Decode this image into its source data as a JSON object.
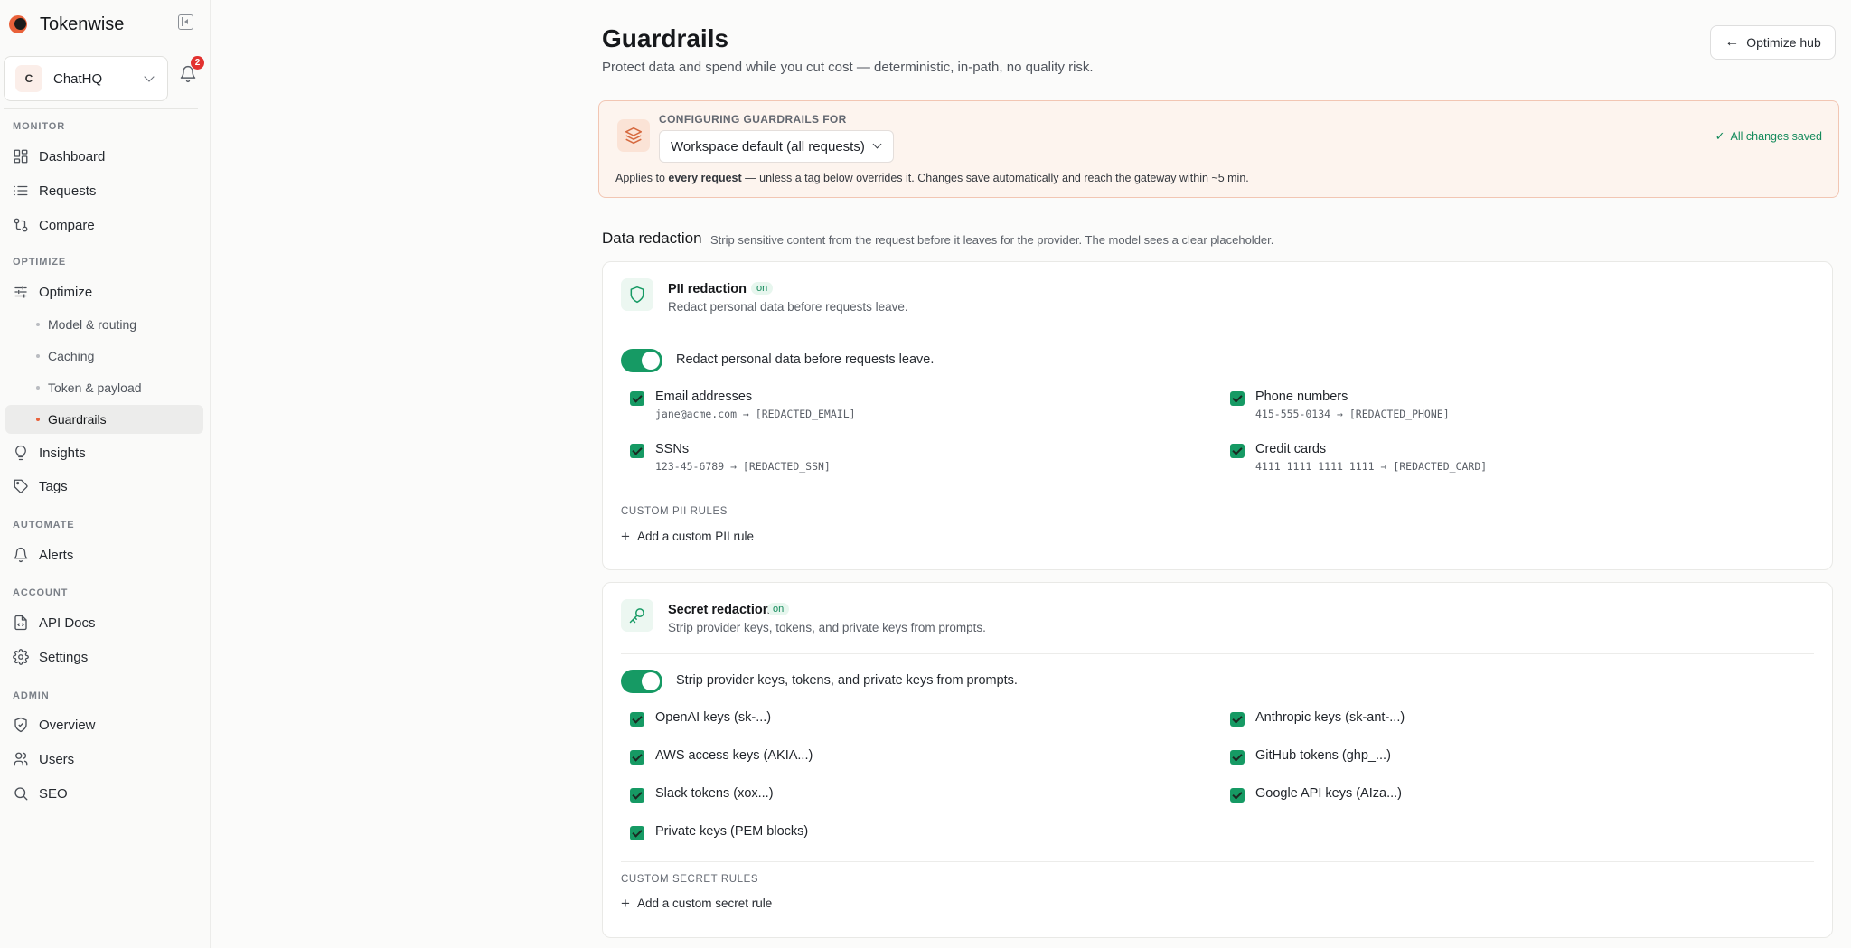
{
  "app": {
    "name": "Tokenwise"
  },
  "workspace": {
    "initial": "C",
    "name": "ChatHQ"
  },
  "notifications": {
    "count": "2"
  },
  "sidebar": {
    "monitor_label": "MONITOR",
    "dashboard": "Dashboard",
    "requests": "Requests",
    "compare": "Compare",
    "optimize_label": "OPTIMIZE",
    "optimize": "Optimize",
    "model_routing": "Model & routing",
    "caching": "Caching",
    "token_payload": "Token & payload",
    "guardrails": "Guardrails",
    "insights": "Insights",
    "tags": "Tags",
    "automate_label": "AUTOMATE",
    "alerts": "Alerts",
    "account_label": "ACCOUNT",
    "api_docs": "API Docs",
    "settings": "Settings",
    "admin_label": "ADMIN",
    "overview": "Overview",
    "users": "Users",
    "seo": "SEO"
  },
  "header": {
    "title": "Guardrails",
    "subtitle": "Protect data and spend while you cut cost — deterministic, in-path, no quality risk.",
    "back_button": "Optimize hub"
  },
  "config": {
    "label": "CONFIGURING GUARDRAILS FOR",
    "selected": "Workspace default (all requests)",
    "note_before": "Applies to ",
    "note_bold": "every request",
    "note_after": " — unless a tag below overrides it. Changes save automatically and reach the gateway within ~5 min.",
    "saved": "All changes saved"
  },
  "data_redaction": {
    "title": "Data redaction",
    "description": "Strip sensitive content from the request before it leaves for the provider. The model sees a clear placeholder."
  },
  "pii": {
    "title": "PII redaction",
    "status": "on",
    "subtitle": "Redact personal data before requests leave.",
    "toggle_label": "Redact personal data before requests leave.",
    "items": [
      {
        "label": "Email addresses",
        "example": "jane@acme.com → [REDACTED_EMAIL]"
      },
      {
        "label": "Phone numbers",
        "example": "415-555-0134 → [REDACTED_PHONE]"
      },
      {
        "label": "SSNs",
        "example": "123-45-6789 → [REDACTED_SSN]"
      },
      {
        "label": "Credit cards",
        "example": "4111 1111 1111 1111 → [REDACTED_CARD]"
      }
    ],
    "custom_label": "CUSTOM PII RULES",
    "add_rule": "Add a custom PII rule"
  },
  "secret": {
    "title": "Secret redaction",
    "status": "on",
    "subtitle": "Strip provider keys, tokens, and private keys from prompts.",
    "toggle_label": "Strip provider keys, tokens, and private keys from prompts.",
    "items": [
      {
        "label": "OpenAI keys (sk-...)"
      },
      {
        "label": "Anthropic keys (sk-ant-...)"
      },
      {
        "label": "AWS access keys (AKIA...)"
      },
      {
        "label": "GitHub tokens (ghp_...)"
      },
      {
        "label": "Slack tokens (xox...)"
      },
      {
        "label": "Google API keys (AIza...)"
      },
      {
        "label": "Private keys (PEM blocks)"
      }
    ],
    "custom_label": "CUSTOM SECRET RULES",
    "add_rule": "Add a custom secret rule"
  },
  "colors": {
    "accent": "#169a64",
    "brand": "#e9613a",
    "badge": "#e2312f",
    "config_bg": "#fdf4ee"
  }
}
